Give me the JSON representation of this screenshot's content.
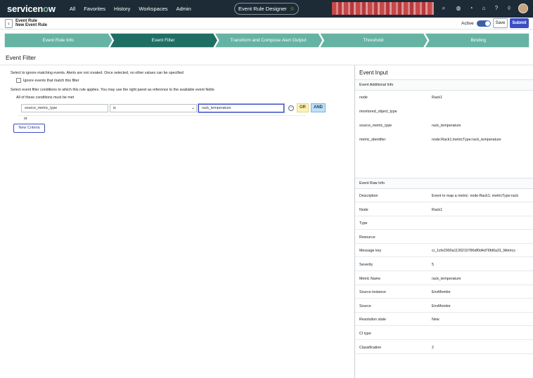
{
  "topbar": {
    "logo_text": "servicenow",
    "nav": [
      "All",
      "Favorites",
      "History",
      "Workspaces",
      "Admin"
    ],
    "designer_title": "Event Rule Designer",
    "icons": [
      "search-icon",
      "globe-icon",
      "help-circle-icon",
      "chat-icon",
      "help-icon",
      "bell-icon",
      "avatar"
    ]
  },
  "header": {
    "crumb_primary": "Event Rule",
    "crumb_secondary": "New Event Rule",
    "active_label": "Active",
    "save_label": "Save",
    "submit_label": "Submit",
    "active": true
  },
  "stepper": {
    "steps": [
      "Event Rule Info",
      "Event Filter",
      "Transform and Compose Alert Output",
      "Threshold",
      "Binding"
    ],
    "active_index": 1,
    "colors": {
      "active": "#1f6e64",
      "inactive": "#66b3a3"
    }
  },
  "filter": {
    "title": "Event Filter",
    "hint_ignore": "Select to ignore matching events. Alerts are not created. Once selected, no other values can be specified",
    "ignore_checkbox_label": "Ignore events that match this filter",
    "hint_conditions": "Select event filter conditions to which this rule applies. You may use the right panel as reference to the available event fields",
    "all_conditions_label": "All of these conditions must be met",
    "condition": {
      "field": "source_metric_type",
      "operator": "is",
      "value": "rack_temperature"
    },
    "or_label": "OR",
    "and_label": "AND",
    "or_text": "or",
    "new_criteria_label": "New Criteria"
  },
  "event_input": {
    "title": "Event Input",
    "additional_header": "Event Additional Info",
    "additional_rows": [
      {
        "key": "node",
        "value": "Rack1"
      },
      {
        "key": "monitored_object_type",
        "value": ""
      },
      {
        "key": "source_metric_type",
        "value": "rack_temperature"
      },
      {
        "key": "metric_identifier",
        "value": "node:Rack1;metricType:rack_temperature"
      }
    ],
    "raw_header": "Event Raw Info",
    "raw_rows": [
      {
        "key": "Description",
        "value": "Event to map a metric: node:Rack1; metricType:rack"
      },
      {
        "key": "Node",
        "value": "Rack1"
      },
      {
        "key": "Type",
        "value": ""
      },
      {
        "key": "Resource",
        "value": ""
      },
      {
        "key": "Message key",
        "value": "ci_1cfe2000a1130210786df0d4d76fd6a31_Metrics"
      },
      {
        "key": "Severity",
        "value": "5"
      },
      {
        "key": "Metric Name",
        "value": "rack_temperature"
      },
      {
        "key": "Source instance",
        "value": "EnvMonitor"
      },
      {
        "key": "Source",
        "value": "EnvMonitor"
      },
      {
        "key": "Resolution state",
        "value": "New"
      },
      {
        "key": "CI type",
        "value": ""
      },
      {
        "key": "Classification",
        "value": "2"
      }
    ]
  }
}
